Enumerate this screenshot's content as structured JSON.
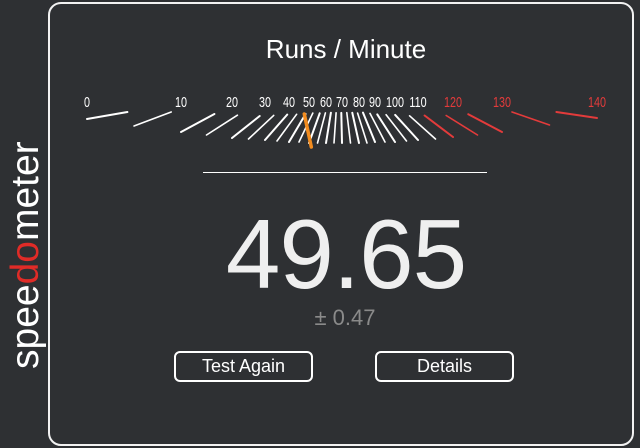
{
  "logo": {
    "text_before": "spee",
    "text_highlight": "do",
    "text_after": "meter",
    "accent_color": "#e02b27"
  },
  "gauge": {
    "title": "Runs / Minute",
    "needle_value": 49.65,
    "needle_color": "#f28c1f",
    "normal_color": "#ffffff",
    "danger_color": "#e33b3b",
    "danger_from": 120,
    "labels": [
      "0",
      "10",
      "20",
      "30",
      "40",
      "50",
      "60",
      "70",
      "80",
      "90",
      "100",
      "110",
      "120",
      "130",
      "140"
    ]
  },
  "result": {
    "score": "49.65",
    "error": "± 0.47"
  },
  "buttons": {
    "test_again": "Test Again",
    "details": "Details"
  }
}
